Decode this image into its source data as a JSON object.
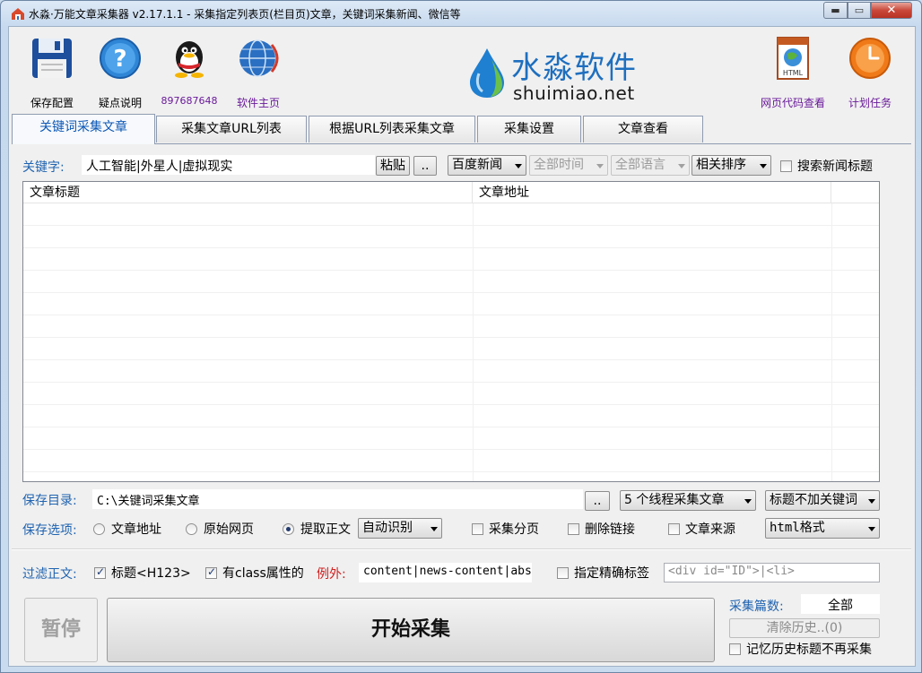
{
  "window": {
    "title": "水淼·万能文章采集器 v2.17.1.1 - 采集指定列表页(栏目页)文章，关键词采集新闻、微信等",
    "min_glyph": "▬",
    "max_glyph": "▭",
    "close_glyph": "✕"
  },
  "toolbar": {
    "save_config": "保存配置",
    "help": "疑点说明",
    "qq": "897687648",
    "homepage": "软件主页",
    "html_viewer": "网页代码查看",
    "schedule": "计划任务"
  },
  "brand": {
    "name": "水淼软件",
    "url": "shuimiao.net"
  },
  "tabs": [
    {
      "label": "关键词采集文章",
      "active": true
    },
    {
      "label": "采集文章URL列表",
      "active": false
    },
    {
      "label": "根据URL列表采集文章",
      "active": false
    },
    {
      "label": "采集设置",
      "active": false
    },
    {
      "label": "文章查看",
      "active": false
    }
  ],
  "keyword": {
    "label": "关键字:",
    "value": "人工智能|外星人|虚拟现实",
    "paste_button": "粘贴",
    "browse_button": "..",
    "source": "百度新闻",
    "time": "全部时间",
    "language": "全部语言",
    "sort": "相关排序",
    "search_title_label": "搜索新闻标题",
    "search_title_checked": false
  },
  "grid": {
    "columns": [
      "文章标题",
      "文章地址"
    ],
    "rows": []
  },
  "save_dir": {
    "label": "保存目录:",
    "value": "C:\\关键词采集文章",
    "browse_button": "..",
    "threads": "5 个线程采集文章",
    "title_keyword": "标题不加关键词"
  },
  "save_options": {
    "label": "保存选项:",
    "radios": [
      {
        "label": "文章地址",
        "checked": false
      },
      {
        "label": "原始网页",
        "checked": false
      },
      {
        "label": "提取正文",
        "checked": true
      }
    ],
    "extract_mode": "自动识别",
    "checkboxes": [
      {
        "label": "采集分页",
        "checked": false
      },
      {
        "label": "删除链接",
        "checked": false
      },
      {
        "label": "文章来源",
        "checked": false
      }
    ],
    "format": "html格式"
  },
  "filter": {
    "label": "过滤正文:",
    "title_h123_label": "标题<H123>",
    "title_h123_checked": true,
    "class_attr_label": "有class属性的",
    "class_attr_checked": true,
    "exception_label": "例外:",
    "exception_value": "content|news-content|abs",
    "exact_tag_label": "指定精确标签",
    "exact_tag_checked": false,
    "exact_tag_placeholder": "<div id=\"ID\">|<li>"
  },
  "actions": {
    "pause": "暂停",
    "start": "开始采集",
    "count_label": "采集篇数:",
    "count_value": "全部",
    "clear_history": "清除历史..(0)",
    "remember_history_label": "记忆历史标题不再采集",
    "remember_history_checked": false
  },
  "colors": {
    "label_blue": "#1f63b0",
    "exception_red": "#d02020",
    "link_purple": "#6a1a9a",
    "active_tab_text": "#0b57b5",
    "brand_blue": "#1e6fbf"
  }
}
